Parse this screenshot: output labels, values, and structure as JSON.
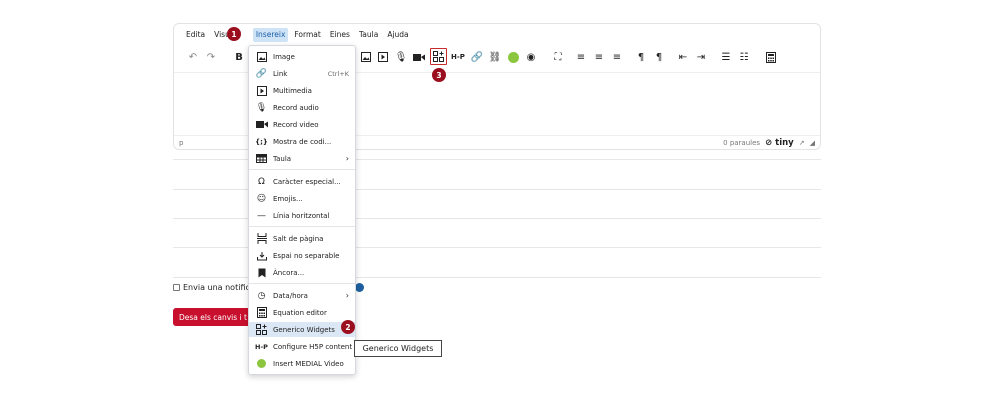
{
  "menubar": [
    "Edita",
    "Visu",
    "Insereix",
    "Format",
    "Eines",
    "Taula",
    "Ajuda"
  ],
  "statusbar": {
    "path": "p",
    "word_count": "0 paraules",
    "brand": "tiny"
  },
  "notify_label": "Envia una notific",
  "save_button": "Desa els canvis i t",
  "dropdown": {
    "image": "Image",
    "link": "Link",
    "link_shortcut": "Ctrl+K",
    "multimedia": "Multimedia",
    "record_audio": "Record audio",
    "record_video": "Record video",
    "code_sample": "Mostra de codi...",
    "table": "Taula",
    "special_char": "Caràcter especial...",
    "emojis": "Emojis...",
    "hr": "Línia horitzontal",
    "page_break": "Salt de pàgina",
    "nbsp": "Espai no separable",
    "anchor": "Àncora...",
    "datetime": "Data/hora",
    "equation": "Equation editor",
    "widgets": "Generico Widgets",
    "h5p": "Configure H5P content",
    "medial": "Insert MEDIAL Video"
  },
  "tooltip": "Generico Widgets",
  "steps": [
    "1",
    "2",
    "3"
  ],
  "colors": {
    "accent": "#c8102e",
    "step_badge": "#9b0e1e",
    "menu_active": "#cfe3f6",
    "hover": "#dbe7f4"
  }
}
